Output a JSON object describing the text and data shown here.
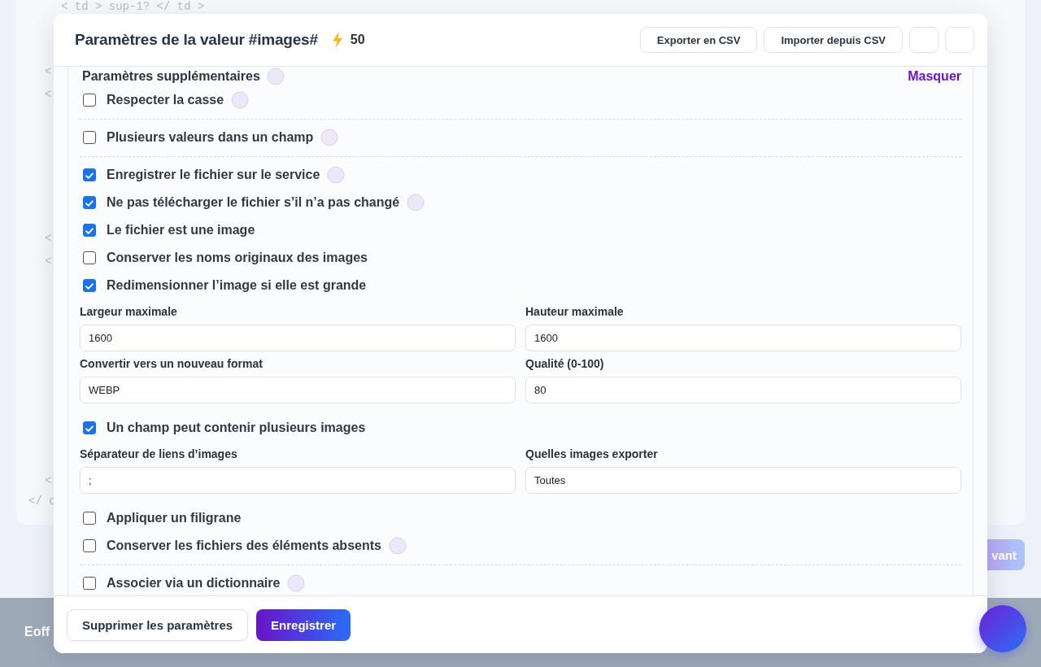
{
  "background": {
    "code_lines": [
      "< td > sup-1? </ td >",
      "<",
      "<",
      "<",
      "<",
      "<",
      "</ c"
    ],
    "footer_text": "Eoff",
    "next_button": "vant"
  },
  "dialog": {
    "title": "Paramètres de la valeur #images#",
    "credits": "50",
    "header_buttons": [
      {
        "kind": "text",
        "label": "Exporter en CSV"
      },
      {
        "kind": "text",
        "label": "Importer depuis CSV"
      },
      {
        "kind": "blank"
      },
      {
        "kind": "blank"
      }
    ],
    "section": {
      "title": "Paramètres supplémentaires",
      "info": true,
      "toggle_link": "Masquer"
    },
    "items": [
      {
        "kind": "checkbox",
        "label": "Respecter la casse",
        "checked": false,
        "info": true
      },
      {
        "kind": "divider"
      },
      {
        "kind": "checkbox",
        "label": "Plusieurs valeurs dans un champ",
        "checked": false,
        "info": true
      },
      {
        "kind": "divider"
      },
      {
        "kind": "checkbox",
        "label": "Enregistrer le fichier sur le service",
        "checked": true,
        "info": true
      },
      {
        "kind": "checkbox",
        "label": "Ne pas télécharger le fichier s’il n’a pas changé",
        "checked": true,
        "info": true
      },
      {
        "kind": "checkbox",
        "label": "Le fichier est une image",
        "checked": true,
        "info": false
      },
      {
        "kind": "checkbox",
        "label": "Conserver les noms originaux des images",
        "checked": false,
        "info": false
      },
      {
        "kind": "checkbox",
        "label": "Redimensionner l’image si elle est grande",
        "checked": true,
        "info": false
      },
      {
        "kind": "fields",
        "fields": [
          {
            "label": "Largeur maximale",
            "value": "1600"
          },
          {
            "label": "Hauteur maximale",
            "value": "1600"
          }
        ]
      },
      {
        "kind": "fields",
        "fields": [
          {
            "label": "Convertir vers un nouveau format",
            "value": "WEBP"
          },
          {
            "label": "Qualité (0-100)",
            "value": "80"
          }
        ]
      },
      {
        "kind": "checkbox",
        "label": "Un champ peut contenir plusieurs images",
        "checked": true,
        "info": false
      },
      {
        "kind": "fields",
        "fields": [
          {
            "label": "Séparateur de liens d’images",
            "value": ";"
          },
          {
            "label": "Quelles images exporter",
            "value": "Toutes"
          }
        ]
      },
      {
        "kind": "checkbox",
        "label": "Appliquer un filigrane",
        "checked": false,
        "info": false
      },
      {
        "kind": "checkbox",
        "label": "Conserver les fichiers des éléments absents",
        "checked": false,
        "info": true
      },
      {
        "kind": "divider"
      },
      {
        "kind": "checkbox",
        "label": "Associer via un dictionnaire",
        "checked": false,
        "info": true
      }
    ],
    "footer_buttons": [
      {
        "kind": "secondary",
        "label": "Supprimer les paramètres"
      },
      {
        "kind": "primary",
        "label": "Enregistrer"
      }
    ]
  }
}
